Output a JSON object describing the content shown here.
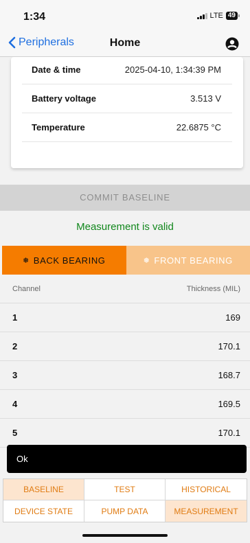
{
  "status_bar": {
    "time": "1:34",
    "network": "LTE",
    "battery": "49"
  },
  "nav": {
    "back_label": "Peripherals",
    "title": "Home"
  },
  "card": {
    "rows": [
      {
        "label": "Date & time",
        "value": "2025-04-10, 1:34:39 PM"
      },
      {
        "label": "Battery voltage",
        "value": "3.513 V"
      },
      {
        "label": "Temperature",
        "value": "22.6875 °C"
      }
    ]
  },
  "commit_button": "COMMIT BASELINE",
  "validity_message": "Measurement is valid",
  "bearing_tabs": [
    {
      "label": "BACK BEARING",
      "symbol": "❅",
      "selected": true
    },
    {
      "label": "FRONT BEARING",
      "symbol": "❅",
      "selected": false
    }
  ],
  "table": {
    "headers": [
      "Channel",
      "Thickness (MIL)"
    ],
    "rows": [
      {
        "channel": "1",
        "thickness": "169"
      },
      {
        "channel": "2",
        "thickness": "170.1"
      },
      {
        "channel": "3",
        "thickness": "168.7"
      },
      {
        "channel": "4",
        "thickness": "169.5"
      },
      {
        "channel": "5",
        "thickness": "170.1"
      }
    ]
  },
  "toast": {
    "label": "Ok"
  },
  "bottom_nav": [
    {
      "label": "BASELINE",
      "selected": true
    },
    {
      "label": "TEST",
      "selected": false
    },
    {
      "label": "HISTORICAL",
      "selected": false
    },
    {
      "label": "DEVICE STATE",
      "selected": false
    },
    {
      "label": "PUMP DATA",
      "selected": false
    },
    {
      "label": "MEASUREMENT",
      "selected": true
    }
  ],
  "colors": {
    "accent": "#f57c00",
    "accent_light": "#f8c48a",
    "valid_green": "#11871c",
    "link_blue": "#1f6fe0"
  }
}
